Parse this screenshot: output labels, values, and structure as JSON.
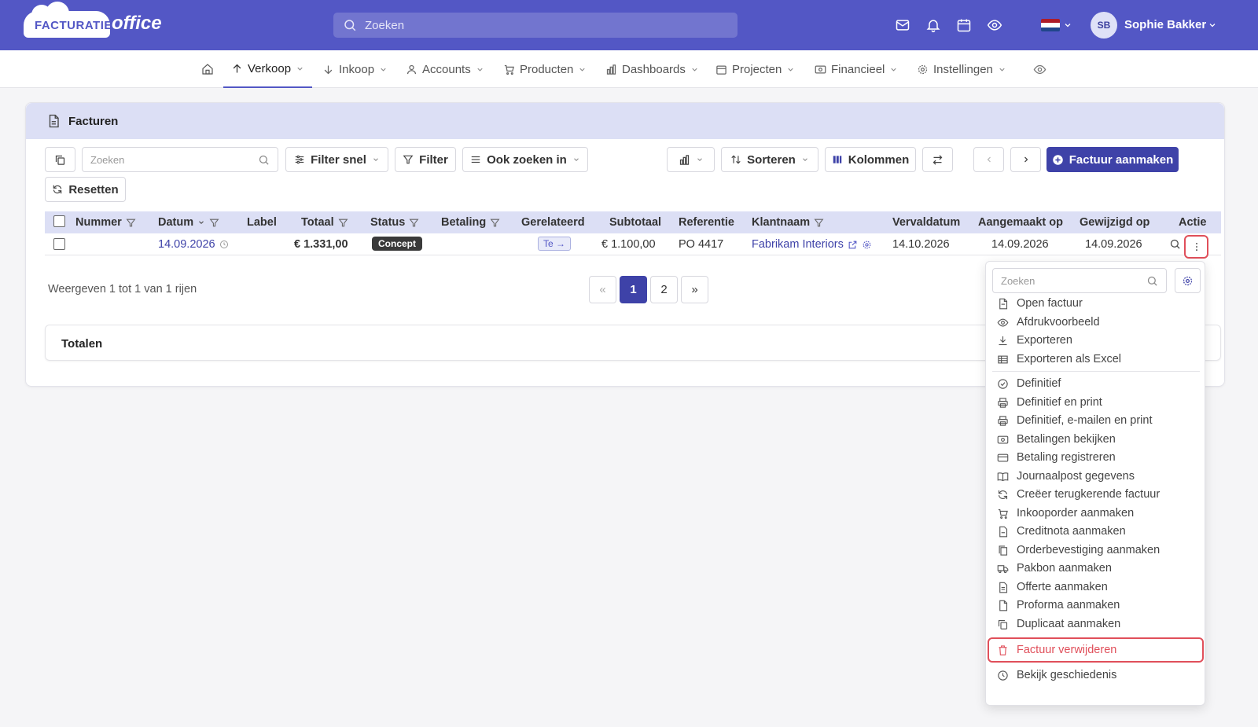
{
  "app": {
    "logo_text_1": "FACTURATIE",
    "logo_text_2": "office",
    "search_placeholder": "Zoeken",
    "user_initials": "SB",
    "user_name": "Sophie Bakker",
    "brand_color": "#5357c5",
    "flag_colors": [
      "#ae1c28",
      "#ffffff",
      "#21468b"
    ]
  },
  "nav": {
    "items": [
      {
        "label": "Verkoop",
        "icon": "arrow-up-icon",
        "active": true
      },
      {
        "label": "Inkoop",
        "icon": "arrow-down-icon"
      },
      {
        "label": "Accounts",
        "icon": "user-icon"
      },
      {
        "label": "Producten",
        "icon": "cart-icon"
      },
      {
        "label": "Dashboards",
        "icon": "bar-chart-icon"
      },
      {
        "label": "Projecten",
        "icon": "calendar-icon"
      },
      {
        "label": "Financieel",
        "icon": "money-icon"
      },
      {
        "label": "Instellingen",
        "icon": "gear-icon"
      }
    ]
  },
  "card": {
    "title": "Facturen",
    "toolbar": {
      "search_placeholder": "Zoeken",
      "filter_quick": "Filter snel",
      "filter": "Filter",
      "search_also": "Ook zoeken in",
      "sort": "Sorteren",
      "columns": "Kolommen",
      "create": "Factuur aanmaken",
      "reset": "Resetten"
    },
    "columns": [
      "Nummer",
      "Datum",
      "Label",
      "Totaal",
      "Status",
      "Betaling",
      "Gerelateerd",
      "Subtotaal",
      "Referentie",
      "Klantnaam",
      "Vervaldatum",
      "Aangemaakt op",
      "Gewijzigd op",
      "Actie"
    ],
    "rows": [
      {
        "nummer": "",
        "datum": "14.09.2026",
        "label": "",
        "totaal": "€ 1.331,00",
        "status": "Concept",
        "betaling": "",
        "gerelateerd": "Te",
        "subtotaal": "€ 1.100,00",
        "referentie": "PO 4417",
        "klantnaam": "Fabrikam Interiors",
        "vervaldatum": "14.10.2026",
        "aangemaakt": "14.09.2026",
        "gewijzigd": "14.09.2026"
      }
    ],
    "pager": {
      "info": "Weergeven 1 tot 1 van 1 rijen",
      "first": "«",
      "pages": [
        "1",
        "2"
      ],
      "last": "»"
    },
    "totals_label": "Totalen"
  },
  "dropdown": {
    "search_placeholder": "Zoeken",
    "group1": [
      {
        "label": "Open factuur",
        "icon": "file-icon"
      },
      {
        "label": "Afdrukvoorbeeld",
        "icon": "eye-icon"
      },
      {
        "label": "Exporteren",
        "icon": "download-icon"
      },
      {
        "label": "Exporteren als Excel",
        "icon": "table-icon"
      }
    ],
    "group2": [
      {
        "label": "Definitief",
        "icon": "check-circle-icon"
      },
      {
        "label": "Definitief en print",
        "icon": "printer-icon"
      },
      {
        "label": "Definitief, e-mailen en print",
        "icon": "printer-icon"
      },
      {
        "label": "Betalingen bekijken",
        "icon": "money-icon"
      },
      {
        "label": "Betaling registreren",
        "icon": "credit-card-icon"
      },
      {
        "label": "Journaalpost gegevens",
        "icon": "book-icon"
      },
      {
        "label": "Creëer terugkerende factuur",
        "icon": "refresh-icon"
      },
      {
        "label": "Inkooporder aanmaken",
        "icon": "cart-icon"
      },
      {
        "label": "Creditnota aanmaken",
        "icon": "file-minus-icon"
      },
      {
        "label": "Orderbevestiging aanmaken",
        "icon": "files-icon"
      },
      {
        "label": "Pakbon aanmaken",
        "icon": "truck-icon"
      },
      {
        "label": "Offerte aanmaken",
        "icon": "file-text-icon"
      },
      {
        "label": "Proforma aanmaken",
        "icon": "file-icon"
      },
      {
        "label": "Duplicaat aanmaken",
        "icon": "copy-icon"
      }
    ],
    "delete": {
      "label": "Factuur verwijderen",
      "icon": "trash-icon",
      "color": "#e04f5a"
    },
    "history": {
      "label": "Bekijk geschiedenis",
      "icon": "clock-icon"
    }
  }
}
